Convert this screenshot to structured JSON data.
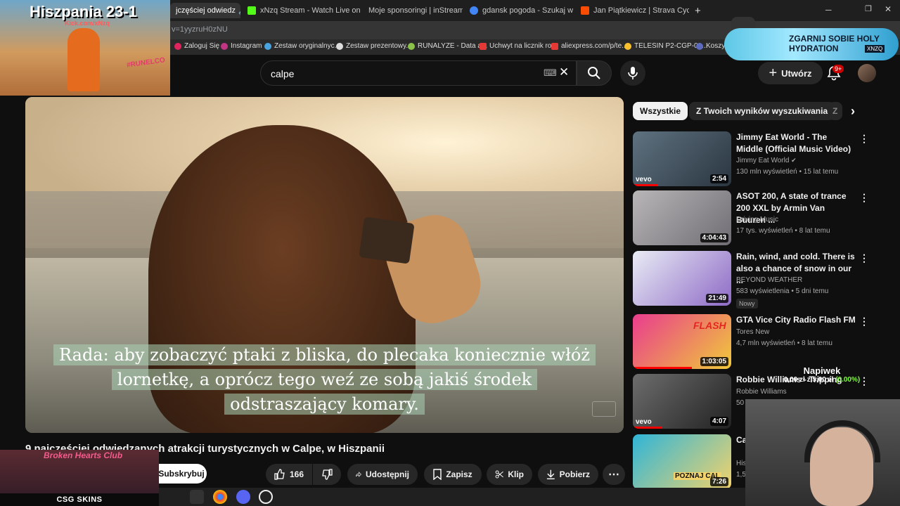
{
  "browser": {
    "tabs": [
      {
        "label": "jczęściej odwiedz",
        "active": true
      },
      {
        "label": "xNzq Stream - Watch Live on K",
        "active": false
      },
      {
        "label": "Moje sponsoringi | inStreamly",
        "active": false
      },
      {
        "label": "gdansk pogoda - Szukaj w Goo",
        "active": false
      },
      {
        "label": "Jan Piątkiewicz | Strava Cyclist",
        "active": false
      }
    ],
    "new_tab": "+",
    "url_fragment": "v=1yyzruH0zNU",
    "bookmarks": [
      "Zaloguj Się",
      "Instagram",
      "Zestaw oryginalnyc...",
      "Zestaw prezentowy...",
      "RUNALYZE - Data a...",
      "Uchwyt na licznik ro...",
      "aliexpress.com/p/te...",
      "TELESIN P2-CGP-01...",
      "Koszyk"
    ]
  },
  "youtube": {
    "search_query": "calpe",
    "create_label": "Utwórz",
    "notif_badge": "9+",
    "video": {
      "subtitle_lines": [
        "Rada: aby zobaczyć ptaki z bliska, do plecaka koniecznie włóż",
        "lornetkę, a oprócz tego weź ze sobą jakiś środek",
        "odstraszający komary."
      ],
      "title": "9 najczęściej odwiedzanych atrakcji turystycznych w Calpe, w Hiszpanii"
    },
    "actions": {
      "subscribe": "Subskrybuj",
      "likes": "166",
      "share": "Udostępnij",
      "save": "Zapisz",
      "clip": "Klip",
      "download": "Pobierz",
      "more": "⋯"
    },
    "chips": [
      "Wszystkie",
      "Z Twoich wyników wyszukiwania",
      "Z"
    ],
    "recommended": [
      {
        "title": "Jimmy Eat World - The Middle (Official Music Video)",
        "channel": "Jimmy Eat World",
        "verified": true,
        "meta": "130 mln wyświetleń • 15 lat temu",
        "duration": "2:54",
        "progress": 0.25,
        "thumb_colors": [
          "#5f7280",
          "#2a3640"
        ],
        "label": "vevo"
      },
      {
        "title": "ASOT 200, A state of trance 200 XXL by Armin Van Buuren ...",
        "channel": "Driving Music",
        "verified": false,
        "meta": "17 tys. wyświetleń • 8 lat temu",
        "duration": "4:04:43",
        "progress": 0,
        "thumb_colors": [
          "#b9b6b8",
          "#6f6d73"
        ],
        "label": ""
      },
      {
        "title": "Rain, wind, and cold. There is also a chance of snow in our ...",
        "channel": "BEYOND WEATHER",
        "verified": false,
        "meta": "583 wyświetlenia • 5 dni temu",
        "duration": "21:49",
        "progress": 0,
        "thumb_colors": [
          "#e9ecf5",
          "#8e6ac6"
        ],
        "label": "",
        "badge": "Nowy"
      },
      {
        "title": "GTA Vice City Radio Flash FM",
        "channel": "Tores New",
        "verified": false,
        "meta": "4,7 mln wyświetleń • 8 lat temu",
        "duration": "1:03:05",
        "progress": 0.6,
        "thumb_colors": [
          "#e93c8e",
          "#f0c93a"
        ],
        "label": "FLASH"
      },
      {
        "title": "Robbie Williams - Tripping",
        "channel": "Robbie Williams",
        "verified": false,
        "meta": "50",
        "duration": "4:07",
        "progress": 0.3,
        "thumb_colors": [
          "#6d6d6d",
          "#222"
        ],
        "label": "vevo"
      },
      {
        "title": "Ca",
        "channel": "His",
        "verified": false,
        "meta": "1,5",
        "duration": "7:26",
        "progress": 0,
        "thumb_colors": [
          "#2fb5d8",
          "#f2d36b"
        ],
        "label": "POZNAJ CAL"
      }
    ]
  },
  "overlays": {
    "top_left_title": "Hiszpania 23-1",
    "top_left_sub": "Kick.com/xNzq",
    "top_left_logo": "#RUNELCO",
    "top_right_text": "ZGARNIJ SOBIE HOLY HYDRATION",
    "top_right_tag": "XNZQ",
    "tip_label": "Napiwek",
    "tip_amount": "0,00 zł",
    "tip_goal": "z 5,00 zł",
    "tip_percent": "(0.00%)",
    "bottom_left_club": "Broken Hearts Club",
    "bottom_left_sponsor": "CSG SKINS"
  },
  "colors": {
    "bg": "#0f0f0f",
    "chip_active_bg": "#f1f1f1",
    "progress": "#ff0000",
    "badge": "#cc0000"
  }
}
